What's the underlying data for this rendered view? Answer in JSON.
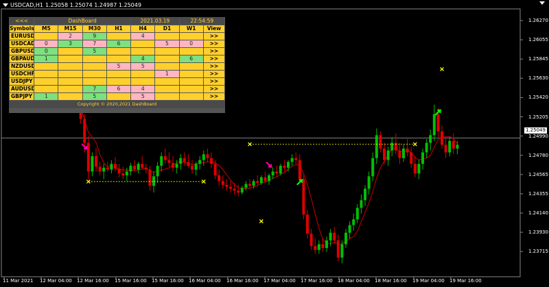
{
  "header": {
    "symbol_info": "USDCAD,H1",
    "ohlc": "1.25058 1.25074 1.24987 1.25049"
  },
  "dashboard": {
    "nav": "<<<",
    "title": "DashBoard",
    "date": "2021.03.19",
    "time": "22:54:59",
    "columns": [
      "Symbols",
      "M5",
      "M15",
      "M30",
      "H1",
      "H4",
      "D1",
      "W1",
      "View"
    ],
    "rows": [
      {
        "symbol": "EURUSD",
        "cells": [
          {
            "v": "",
            "c": "empty"
          },
          {
            "v": "2",
            "c": "red"
          },
          {
            "v": "9",
            "c": "green"
          },
          {
            "v": "",
            "c": "empty"
          },
          {
            "v": "4",
            "c": "red"
          },
          {
            "v": "",
            "c": "empty"
          },
          {
            "v": "",
            "c": "empty"
          }
        ],
        "view": ">>"
      },
      {
        "symbol": "USDCAD",
        "cells": [
          {
            "v": "0",
            "c": "red"
          },
          {
            "v": "3",
            "c": "green"
          },
          {
            "v": "7",
            "c": "red"
          },
          {
            "v": "6",
            "c": "green"
          },
          {
            "v": "",
            "c": "empty"
          },
          {
            "v": "5",
            "c": "red"
          },
          {
            "v": "0",
            "c": "red"
          }
        ],
        "view": ">>"
      },
      {
        "symbol": "GBPUSD",
        "cells": [
          {
            "v": "0",
            "c": "green"
          },
          {
            "v": "",
            "c": "empty"
          },
          {
            "v": "5",
            "c": "green"
          },
          {
            "v": "",
            "c": "empty"
          },
          {
            "v": "",
            "c": "empty"
          },
          {
            "v": "",
            "c": "empty"
          },
          {
            "v": "",
            "c": "empty"
          }
        ],
        "view": ">>"
      },
      {
        "symbol": "GBPAUD",
        "cells": [
          {
            "v": "1",
            "c": "green"
          },
          {
            "v": "",
            "c": "empty"
          },
          {
            "v": "",
            "c": "empty"
          },
          {
            "v": "",
            "c": "empty"
          },
          {
            "v": "4",
            "c": "green"
          },
          {
            "v": "",
            "c": "empty"
          },
          {
            "v": "6",
            "c": "green"
          }
        ],
        "view": ">>"
      },
      {
        "symbol": "NZDUSD",
        "cells": [
          {
            "v": "",
            "c": "empty"
          },
          {
            "v": "",
            "c": "empty"
          },
          {
            "v": "",
            "c": "empty"
          },
          {
            "v": "5",
            "c": "red"
          },
          {
            "v": "5",
            "c": "red"
          },
          {
            "v": "",
            "c": "empty"
          },
          {
            "v": "",
            "c": "empty"
          }
        ],
        "view": ">>"
      },
      {
        "symbol": "USDCHF",
        "cells": [
          {
            "v": "",
            "c": "empty"
          },
          {
            "v": "",
            "c": "empty"
          },
          {
            "v": "",
            "c": "empty"
          },
          {
            "v": "",
            "c": "empty"
          },
          {
            "v": "",
            "c": "empty"
          },
          {
            "v": "1",
            "c": "red"
          },
          {
            "v": "",
            "c": "empty"
          }
        ],
        "view": ">>"
      },
      {
        "symbol": "USDJPY",
        "cells": [
          {
            "v": "",
            "c": "empty"
          },
          {
            "v": "",
            "c": "empty"
          },
          {
            "v": "",
            "c": "empty"
          },
          {
            "v": "",
            "c": "empty"
          },
          {
            "v": "",
            "c": "empty"
          },
          {
            "v": "",
            "c": "empty"
          },
          {
            "v": "",
            "c": "empty"
          }
        ],
        "view": ">>"
      },
      {
        "symbol": "AUDUSD",
        "cells": [
          {
            "v": "",
            "c": "empty"
          },
          {
            "v": "",
            "c": "empty"
          },
          {
            "v": "7",
            "c": "green"
          },
          {
            "v": "6",
            "c": "red"
          },
          {
            "v": "4",
            "c": "red"
          },
          {
            "v": "",
            "c": "empty"
          },
          {
            "v": "",
            "c": "empty"
          }
        ],
        "view": ">>"
      },
      {
        "symbol": "GBPJPY",
        "cells": [
          {
            "v": "1",
            "c": "green"
          },
          {
            "v": "",
            "c": "empty"
          },
          {
            "v": "5",
            "c": "green"
          },
          {
            "v": "",
            "c": "empty"
          },
          {
            "v": "5",
            "c": "red"
          },
          {
            "v": "",
            "c": "empty"
          },
          {
            "v": "",
            "c": "empty"
          }
        ],
        "view": ">>"
      }
    ],
    "copyright": "Copyright © 2020,2021 DashBoard"
  },
  "price_axis": {
    "labels": [
      "1.26270",
      "1.26055",
      "1.25845",
      "1.25630",
      "1.25420",
      "1.25205",
      "1.24990",
      "1.24780",
      "1.24565",
      "1.24355",
      "1.24140",
      "1.23930",
      "1.23715"
    ],
    "current_price": "1.25049"
  },
  "time_axis": {
    "labels": [
      "11 Mar 2021",
      "12 Mar 04:00",
      "12 Mar 16:00",
      "15 Mar 16:00",
      "15 Mar 16:00",
      "16 Mar 04:00",
      "16 Mar 16:00",
      "17 Mar 04:00",
      "17 Mar 16:00",
      "18 Mar 04:00",
      "18 Mar 16:00",
      "19 Mar 04:00",
      "19 Mar 16:00"
    ]
  },
  "colors": {
    "bull": "#00c000",
    "bear": "#e00000",
    "ma_line": "#cc0000",
    "signal_x": "#ffff00",
    "arrow_up": "#00ff00",
    "arrow_down": "#ff00a0"
  },
  "chart_data": {
    "type": "candlestick",
    "ylim": [
      1.236,
      1.264
    ],
    "moving_average": true,
    "candles": [
      [
        1.2555,
        1.257,
        1.254,
        1.2548
      ],
      [
        1.2548,
        1.2556,
        1.252,
        1.2525
      ],
      [
        1.2525,
        1.253,
        1.249,
        1.25
      ],
      [
        1.25,
        1.2508,
        1.2462,
        1.247
      ],
      [
        1.247,
        1.249,
        1.2465,
        1.2486
      ],
      [
        1.2486,
        1.2495,
        1.247,
        1.2475
      ],
      [
        1.2475,
        1.248,
        1.2466,
        1.247
      ],
      [
        1.247,
        1.2478,
        1.2462,
        1.2474
      ],
      [
        1.2474,
        1.248,
        1.247,
        1.2472
      ],
      [
        1.2472,
        1.2482,
        1.2468,
        1.2478
      ],
      [
        1.2478,
        1.2485,
        1.247,
        1.2473
      ],
      [
        1.2473,
        1.2478,
        1.2464,
        1.2468
      ],
      [
        1.2468,
        1.2475,
        1.2462,
        1.2466
      ],
      [
        1.2466,
        1.2474,
        1.246,
        1.247
      ],
      [
        1.247,
        1.2479,
        1.2466,
        1.2476
      ],
      [
        1.2476,
        1.2482,
        1.247,
        1.2472
      ],
      [
        1.2472,
        1.248,
        1.2468,
        1.2478
      ],
      [
        1.2478,
        1.2486,
        1.2472,
        1.2474
      ],
      [
        1.2474,
        1.2478,
        1.2468,
        1.2472
      ],
      [
        1.2472,
        1.2476,
        1.245,
        1.2455
      ],
      [
        1.2455,
        1.247,
        1.2448,
        1.2465
      ],
      [
        1.2465,
        1.248,
        1.2458,
        1.2476
      ],
      [
        1.2476,
        1.249,
        1.247,
        1.2486
      ],
      [
        1.2486,
        1.2494,
        1.2478,
        1.2482
      ],
      [
        1.2482,
        1.249,
        1.2475,
        1.2479
      ],
      [
        1.2479,
        1.2486,
        1.247,
        1.2474
      ],
      [
        1.2474,
        1.2482,
        1.2468,
        1.2478
      ],
      [
        1.2478,
        1.2488,
        1.2472,
        1.2484
      ],
      [
        1.2484,
        1.249,
        1.2476,
        1.248
      ],
      [
        1.248,
        1.2488,
        1.2474,
        1.2476
      ],
      [
        1.2476,
        1.2482,
        1.2468,
        1.2472
      ],
      [
        1.2472,
        1.248,
        1.2466,
        1.2478
      ],
      [
        1.2478,
        1.2486,
        1.2472,
        1.2482
      ],
      [
        1.2482,
        1.2492,
        1.2476,
        1.2488
      ],
      [
        1.2488,
        1.2494,
        1.248,
        1.2484
      ],
      [
        1.2484,
        1.249,
        1.2474,
        1.2478
      ],
      [
        1.2478,
        1.2482,
        1.2462,
        1.2466
      ],
      [
        1.2466,
        1.2472,
        1.2455,
        1.246
      ],
      [
        1.246,
        1.2466,
        1.2452,
        1.2456
      ],
      [
        1.2456,
        1.2462,
        1.245,
        1.2454
      ],
      [
        1.2454,
        1.246,
        1.2448,
        1.2452
      ],
      [
        1.2452,
        1.2458,
        1.2446,
        1.245
      ],
      [
        1.245,
        1.2456,
        1.2444,
        1.2448
      ],
      [
        1.2448,
        1.2455,
        1.2446,
        1.2453
      ],
      [
        1.2453,
        1.246,
        1.245,
        1.2457
      ],
      [
        1.2457,
        1.2462,
        1.2452,
        1.2455
      ],
      [
        1.2455,
        1.2462,
        1.2452,
        1.246
      ],
      [
        1.246,
        1.2466,
        1.2455,
        1.2458
      ],
      [
        1.2458,
        1.2466,
        1.2456,
        1.2464
      ],
      [
        1.2464,
        1.247,
        1.2458,
        1.246
      ],
      [
        1.246,
        1.2468,
        1.2456,
        1.2466
      ],
      [
        1.2466,
        1.2474,
        1.2462,
        1.247
      ],
      [
        1.247,
        1.2476,
        1.2464,
        1.2468
      ],
      [
        1.2468,
        1.2478,
        1.2466,
        1.2476
      ],
      [
        1.2476,
        1.2482,
        1.247,
        1.2474
      ],
      [
        1.2474,
        1.2482,
        1.247,
        1.248
      ],
      [
        1.248,
        1.2488,
        1.2476,
        1.2484
      ],
      [
        1.2484,
        1.249,
        1.2478,
        1.2482
      ],
      [
        1.2482,
        1.2488,
        1.2458,
        1.2462
      ],
      [
        1.2462,
        1.2466,
        1.242,
        1.2425
      ],
      [
        1.2425,
        1.243,
        1.24,
        1.2405
      ],
      [
        1.2405,
        1.241,
        1.2388,
        1.2392
      ],
      [
        1.2392,
        1.24,
        1.2384,
        1.2388
      ],
      [
        1.2388,
        1.2398,
        1.2384,
        1.2394
      ],
      [
        1.2394,
        1.24,
        1.2386,
        1.239
      ],
      [
        1.239,
        1.2402,
        1.2386,
        1.2398
      ],
      [
        1.2398,
        1.241,
        1.2392,
        1.2406
      ],
      [
        1.2406,
        1.2412,
        1.2394,
        1.2398
      ],
      [
        1.2398,
        1.2404,
        1.2376,
        1.238
      ],
      [
        1.238,
        1.2398,
        1.2374,
        1.2394
      ],
      [
        1.2394,
        1.241,
        1.239,
        1.2406
      ],
      [
        1.2406,
        1.2418,
        1.24,
        1.2414
      ],
      [
        1.2414,
        1.2426,
        1.2408,
        1.242
      ],
      [
        1.242,
        1.2436,
        1.2416,
        1.2432
      ],
      [
        1.2432,
        1.2446,
        1.2426,
        1.244
      ],
      [
        1.244,
        1.2456,
        1.2434,
        1.2452
      ],
      [
        1.2452,
        1.247,
        1.2446,
        1.2465
      ],
      [
        1.2465,
        1.249,
        1.246,
        1.2484
      ],
      [
        1.2484,
        1.2515,
        1.2478,
        1.2508
      ],
      [
        1.2508,
        1.2512,
        1.249,
        1.2494
      ],
      [
        1.2494,
        1.25,
        1.2478,
        1.2482
      ],
      [
        1.2482,
        1.2496,
        1.2476,
        1.2492
      ],
      [
        1.2492,
        1.2506,
        1.2486,
        1.25
      ],
      [
        1.25,
        1.251,
        1.2488,
        1.2492
      ],
      [
        1.2492,
        1.25,
        1.2478,
        1.2484
      ],
      [
        1.2484,
        1.2498,
        1.248,
        1.2494
      ],
      [
        1.2494,
        1.2504,
        1.2486,
        1.249
      ],
      [
        1.249,
        1.2496,
        1.2474,
        1.2478
      ],
      [
        1.2478,
        1.2486,
        1.2464,
        1.2468
      ],
      [
        1.2468,
        1.2482,
        1.2462,
        1.2478
      ],
      [
        1.2478,
        1.2494,
        1.2472,
        1.249
      ],
      [
        1.249,
        1.2504,
        1.2484,
        1.25
      ],
      [
        1.25,
        1.2514,
        1.2492,
        1.2508
      ],
      [
        1.2508,
        1.254,
        1.2502,
        1.253
      ],
      [
        1.253,
        1.2536,
        1.2506,
        1.2512
      ],
      [
        1.2512,
        1.2518,
        1.2494,
        1.2498
      ],
      [
        1.2498,
        1.2506,
        1.2484,
        1.249
      ],
      [
        1.249,
        1.2506,
        1.2486,
        1.2502
      ],
      [
        1.2502,
        1.251,
        1.2488,
        1.2494
      ],
      [
        1.2494,
        1.2502,
        1.2488,
        1.2498
      ]
    ],
    "signal_lines": [
      {
        "from_index": 3,
        "to_index": 33,
        "price": 1.24595
      },
      {
        "from_index": 45,
        "to_index": 88,
        "price": 1.24985
      }
    ],
    "x_markers": [
      {
        "index": 3,
        "price": 1.24595
      },
      {
        "index": 33,
        "price": 1.24595
      },
      {
        "index": 45,
        "price": 1.24985
      },
      {
        "index": 88,
        "price": 1.24985
      },
      {
        "index": 48,
        "price": 1.2418
      },
      {
        "index": 95,
        "price": 1.2577
      }
    ],
    "arrows": [
      {
        "index": 2,
        "price": 1.2496,
        "dir": "down"
      },
      {
        "index": 50,
        "price": 1.2477,
        "dir": "down"
      },
      {
        "index": 58,
        "price": 1.2459,
        "dir": "up"
      },
      {
        "index": 94,
        "price": 1.2532,
        "dir": "up"
      }
    ]
  }
}
